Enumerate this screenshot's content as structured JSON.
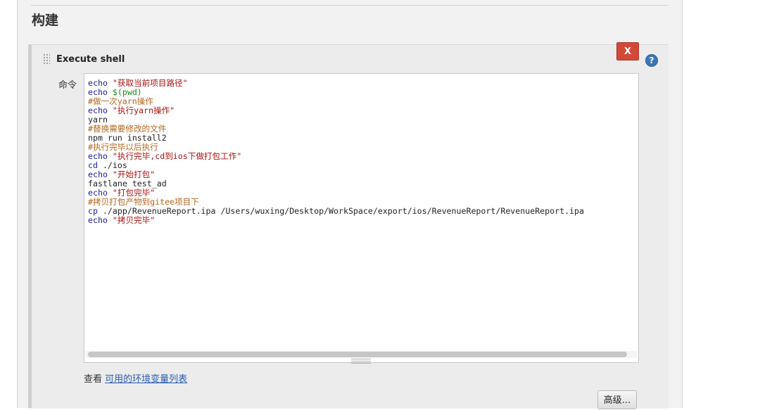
{
  "section": {
    "title": "构建"
  },
  "step": {
    "title": "Execute shell",
    "delete_label": "X",
    "help_label": "?",
    "command_label": "命令"
  },
  "editor": {
    "lines": [
      [
        {
          "t": "echo ",
          "c": "kw"
        },
        {
          "t": "\"获取当前项目路径\"",
          "c": "str"
        }
      ],
      [
        {
          "t": "echo ",
          "c": "kw"
        },
        {
          "t": "$(pwd)",
          "c": "var"
        }
      ],
      [
        {
          "t": "#做一次yarn操作",
          "c": "cmt"
        }
      ],
      [
        {
          "t": "echo ",
          "c": "kw"
        },
        {
          "t": "\"执行yarn操作\"",
          "c": "str"
        }
      ],
      [
        {
          "t": "yarn",
          "c": ""
        }
      ],
      [
        {
          "t": "#替换需要修改的文件",
          "c": "cmt"
        }
      ],
      [
        {
          "t": "npm run install2",
          "c": ""
        }
      ],
      [
        {
          "t": "#执行完毕以后执行",
          "c": "cmt"
        }
      ],
      [
        {
          "t": "echo ",
          "c": "kw"
        },
        {
          "t": "\"执行完毕,cd到ios下做打包工作\"",
          "c": "str"
        }
      ],
      [
        {
          "t": "cd ",
          "c": "kw"
        },
        {
          "t": "./ios",
          "c": ""
        }
      ],
      [
        {
          "t": "echo ",
          "c": "kw"
        },
        {
          "t": "\"开始打包\"",
          "c": "str"
        }
      ],
      [
        {
          "t": "fastlane test_ad",
          "c": ""
        }
      ],
      [
        {
          "t": "echo ",
          "c": "kw"
        },
        {
          "t": "\"打包完毕\"",
          "c": "str"
        }
      ],
      [
        {
          "t": "#拷贝打包产物到gitee项目下",
          "c": "cmt"
        }
      ],
      [
        {
          "t": "cp ",
          "c": "kw"
        },
        {
          "t": "./app/RevenueReport.ipa /Users/wuxing/Desktop/WorkSpace/export/ios/RevenueReport/RevenueReport.ipa",
          "c": ""
        }
      ],
      [
        {
          "t": "echo ",
          "c": "kw"
        },
        {
          "t": "\"拷贝完毕\"",
          "c": "str"
        }
      ]
    ]
  },
  "footer": {
    "view_prefix": "查看 ",
    "env_link": "可用的环境变量列表",
    "advanced_label": "高级..."
  },
  "colors": {
    "delete_button": "#d24939",
    "help_icon": "#3a77b7",
    "link": "#2a5db0"
  }
}
